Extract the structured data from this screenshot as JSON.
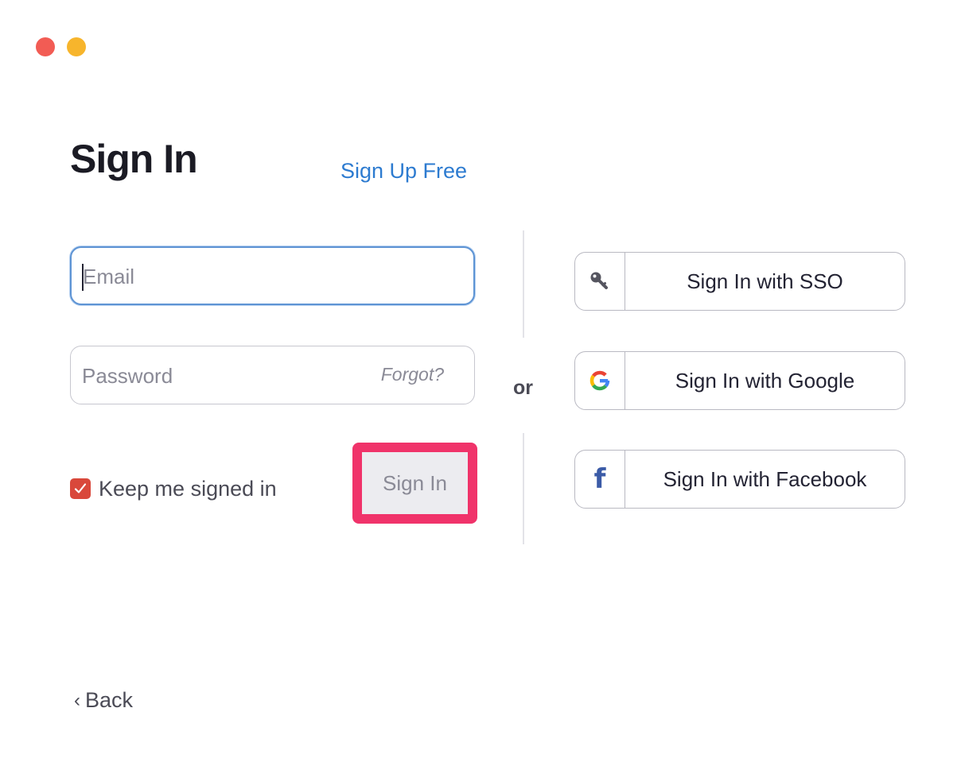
{
  "window": {
    "controls": [
      "close",
      "minimize"
    ]
  },
  "header": {
    "title": "Sign In",
    "signup_link": "Sign Up Free"
  },
  "form": {
    "email": {
      "value": "",
      "placeholder": "Email"
    },
    "password": {
      "value": "",
      "placeholder": "Password",
      "forgot_link": "Forgot?"
    },
    "keep_signed_in": {
      "label": "Keep me signed in",
      "checked": true
    },
    "submit_label": "Sign In"
  },
  "separator": {
    "label": "or"
  },
  "alt_signin": [
    {
      "label": "Sign In with SSO",
      "icon": "key-icon"
    },
    {
      "label": "Sign In with Google",
      "icon": "google-icon"
    },
    {
      "label": "Sign In with Facebook",
      "icon": "facebook-icon"
    }
  ],
  "footer": {
    "back_label": "Back"
  },
  "colors": {
    "accent_blue": "#2d7bd0",
    "highlight": "#f0336a",
    "checkbox": "#d9483b",
    "close": "#f25c54",
    "minimize": "#f7b52c",
    "facebook": "#3b5ba7"
  }
}
